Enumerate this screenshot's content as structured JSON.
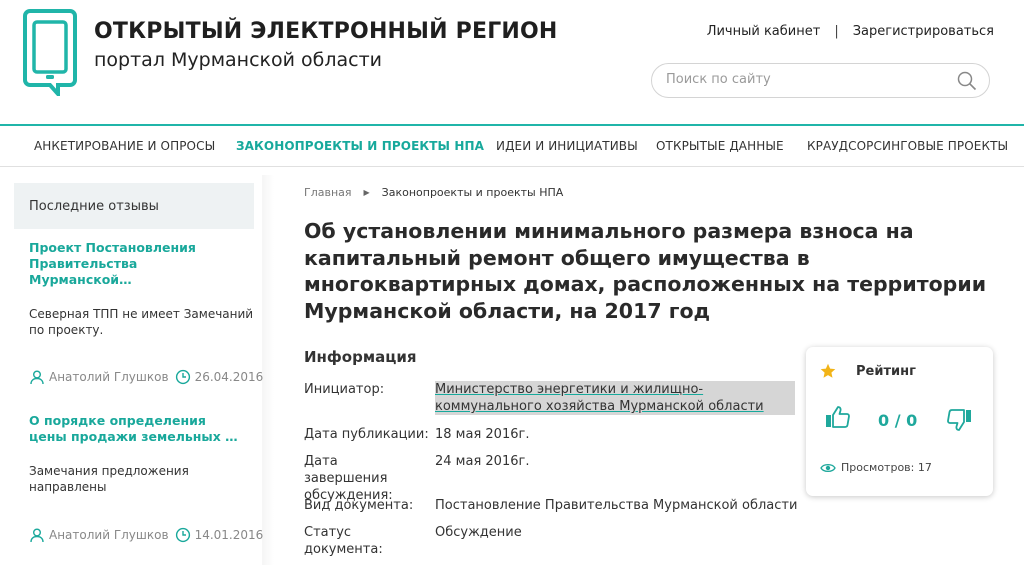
{
  "header": {
    "site_title": "ОТКРЫТЫЙ ЭЛЕКТРОННЫЙ РЕГИОН",
    "site_subtitle": "портал Мурманской области",
    "login_link": "Личный кабинет",
    "register_link": "Зарегистрироваться",
    "search_placeholder": "Поиск по сайту"
  },
  "nav": {
    "items": [
      {
        "label": "АНКЕТИРОВАНИЕ И ОПРОСЫ"
      },
      {
        "label": "ЗАКОНОПРОЕКТЫ И ПРОЕКТЫ НПА"
      },
      {
        "label": "ИДЕИ И ИНИЦИАТИВЫ"
      },
      {
        "label": "ОТКРЫТЫЕ ДАННЫЕ"
      },
      {
        "label": "КРАУДСОРСИНГОВЫЕ ПРОЕКТЫ"
      }
    ],
    "active_index": 1
  },
  "sidebar": {
    "heading": "Последние отзывы",
    "reviews": [
      {
        "title": "Проект Постановления Правительства Мурманской…",
        "text": "Северная ТПП не имеет Замечаний по проекту.",
        "author": "Анатолий Глушков",
        "date": "26.04.2016"
      },
      {
        "title": "О порядке определения цены продажи земельных …",
        "text": "Замечания предложения направлены",
        "author": "Анатолий Глушков",
        "date": "14.01.2016"
      }
    ]
  },
  "breadcrumb": {
    "home": "Главная",
    "current": "Законопроекты и проекты НПА"
  },
  "document": {
    "title": "Об установлении минимального размера взноса на капитальный ремонт общего имущества в многоквартирных домах, расположенных на территории Мурманской области, на 2017 год",
    "info_heading": "Информация",
    "fields": [
      {
        "label": "Инициатор:",
        "value": "Министерство энергетики и жилищно-коммунального хозяйства Мурманской области"
      },
      {
        "label": "Дата публикации:",
        "value": "18 мая 2016г."
      },
      {
        "label": "Дата завершения обсуждения:",
        "value": "24 мая 2016г."
      },
      {
        "label": "Вид документа:",
        "value": "Постановление Правительства Мурманской области"
      },
      {
        "label": "Статус документа:",
        "value": "Обсуждение"
      }
    ]
  },
  "rating": {
    "title": "Рейтинг",
    "score": "0 / 0",
    "views": "Просмотров: 17"
  },
  "colors": {
    "accent": "#1fa89c",
    "sidebar_bg": "#eef2f3"
  }
}
